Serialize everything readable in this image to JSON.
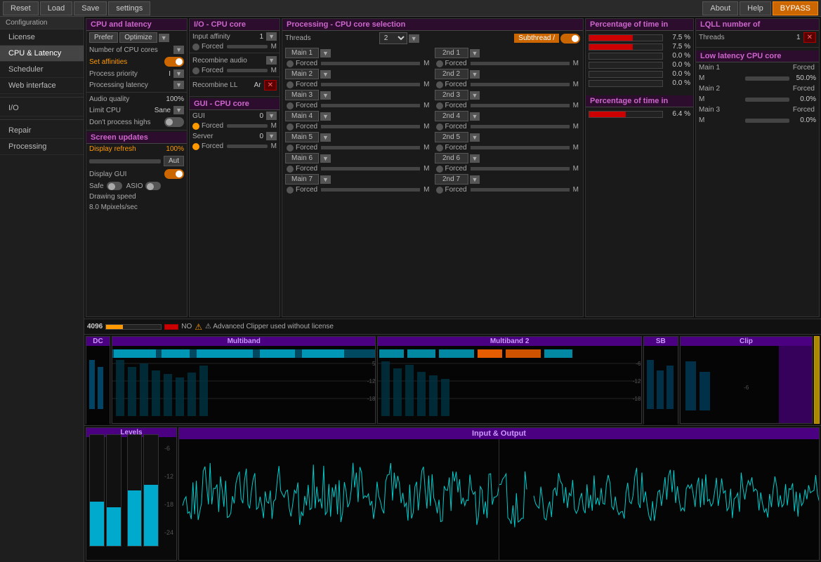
{
  "topbar": {
    "reset": "Reset",
    "load": "Load",
    "save": "Save",
    "settings": "settings",
    "about": "About",
    "help": "Help",
    "bypass": "BYPASS"
  },
  "sidebar": {
    "config_label": "Configuration",
    "items": [
      {
        "label": "License",
        "active": false
      },
      {
        "label": "CPU & Latency",
        "active": true
      },
      {
        "label": "Scheduler",
        "active": false
      },
      {
        "label": "Web interface",
        "active": false
      },
      {
        "label": "I/O",
        "active": false
      },
      {
        "label": "Repair",
        "active": false
      },
      {
        "label": "Processing",
        "active": false
      }
    ]
  },
  "cpu_latency": {
    "title": "CPU and latency",
    "prefer_label": "Prefer",
    "optimize_label": "Optimize",
    "num_cpu_label": "Number of CPU cores",
    "set_affinities_label": "Set affinities",
    "process_priority_label": "Process priority",
    "process_priority_val": "I",
    "processing_latency_label": "Processing latency",
    "audio_quality_label": "Audio quality",
    "audio_quality_val": "100%",
    "limit_cpu_label": "Limit CPU",
    "limit_cpu_val": "Sane",
    "dont_process_highs": "Don't process highs"
  },
  "screen_updates": {
    "title": "Screen updates",
    "display_refresh": "Display refresh",
    "display_refresh_val": "100%",
    "display_refresh_mode": "Aut",
    "display_gui": "Display GUI",
    "safe_label": "Safe",
    "asio_label": "ASIO",
    "drawing_speed": "Drawing speed",
    "drawing_speed_val": "8.0 Mpixels/sec"
  },
  "io_cpu": {
    "title": "I/O - CPU core",
    "input_affinity": "Input affinity",
    "input_val": "1",
    "forced1": "Forced",
    "m1": "M",
    "recombine": "Recombine audio",
    "forced2": "Forced",
    "m2": "M",
    "recombine_ll": "Recombine LL",
    "recombine_ll_val": "Ar"
  },
  "gui_cpu": {
    "title": "GUI - CPU core",
    "gui_label": "GUI",
    "gui_val": "0",
    "forced_gui": "Forced",
    "m_gui": "M",
    "server_label": "Server",
    "server_val": "0",
    "forced_server": "Forced",
    "m_server": "M"
  },
  "processing": {
    "title": "Processing - CPU core selection",
    "threads_label": "Threads",
    "threads_val": "2",
    "subthread": "Subthread /",
    "threads": [
      {
        "label": "Main 1",
        "forced": "Forced",
        "m": "M",
        "nd": "2nd 1",
        "forced2": "Forced",
        "m2": "M"
      },
      {
        "label": "Main 2",
        "forced": "Forced",
        "m": "M",
        "nd": "2nd 2",
        "forced2": "Forced",
        "m2": "M"
      },
      {
        "label": "Main 3",
        "forced": "Forced",
        "m": "M",
        "nd": "2nd 3",
        "forced2": "Forced",
        "m2": "M"
      },
      {
        "label": "Main 4",
        "forced": "Forced",
        "m": "M",
        "nd": "2nd 4",
        "forced2": "Forced",
        "m2": "M"
      },
      {
        "label": "Main 5",
        "forced": "Forced",
        "m": "M",
        "nd": "2nd 5",
        "forced2": "Forced",
        "m2": "M"
      },
      {
        "label": "Main 6",
        "forced": "Forced",
        "m": "M",
        "nd": "2nd 6",
        "forced2": "Forced",
        "m2": "M"
      },
      {
        "label": "Main 7",
        "forced": "Forced",
        "m": "M",
        "nd": "2nd 7",
        "forced2": "Forced",
        "m2": "M"
      }
    ]
  },
  "pct_time1": {
    "title": "Percentage of time in",
    "bar1": 7.5,
    "bar2": 7.5,
    "bar3": 0.0,
    "bar4": 0.0,
    "bar5": 0.0,
    "bar6": 0.0,
    "bar1_txt": "7.5 %",
    "bar2_txt": "7.5 %",
    "bar3_txt": "0.0 %",
    "bar4_txt": "0.0 %",
    "bar5_txt": "0.0 %",
    "bar6_txt": "0.0 %"
  },
  "pct_time2": {
    "title": "Percentage of time in",
    "bar1": 6.4,
    "bar1_txt": "6.4 %"
  },
  "lqll": {
    "title": "LQLL number of",
    "threads_label": "Threads",
    "threads_val": "1",
    "low_latency_title": "Low latency CPU core",
    "cores": [
      {
        "label": "Main 1",
        "forced": "Forced",
        "m": "M",
        "val": "50.0%"
      },
      {
        "label": "Main 2",
        "forced": "Forced",
        "m": "M",
        "val": "0.0%"
      },
      {
        "label": "Main 3",
        "forced": "Forced",
        "m": "M",
        "val": "0.0%"
      }
    ]
  },
  "status_bar": {
    "num": "4096",
    "no_label": "NO",
    "warning": "⚠ Advanced Clipper used without license"
  },
  "viz": {
    "dc_label": "DC",
    "multiband_label": "Multiband",
    "multiband2_label": "Multiband 2",
    "sb_label": "SB",
    "clip_label": "Clip"
  },
  "bottom": {
    "levels_label": "Levels",
    "io_label": "Input & Output"
  }
}
